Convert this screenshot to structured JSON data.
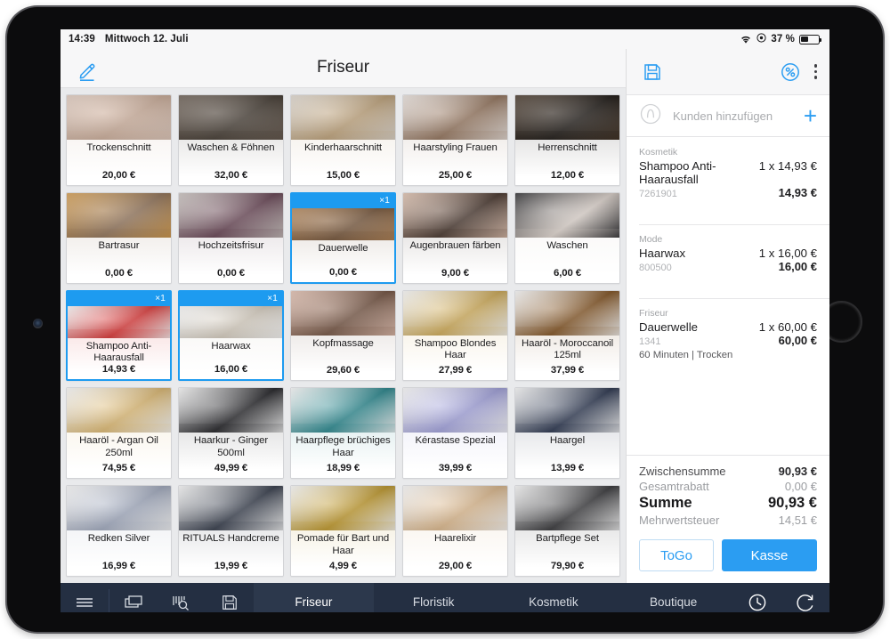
{
  "status_bar": {
    "time": "14:39",
    "date": "Mittwoch 12. Juli",
    "battery_percent": "37 %",
    "wifi_icon": "wifi-icon",
    "location_icon": "location-icon",
    "battery_icon": "battery-icon"
  },
  "left_header": {
    "edit_icon": "pencil-edit-icon",
    "title": "Friseur"
  },
  "products": [
    {
      "name": "Trockenschnitt",
      "price": "20,00 €",
      "selected": false,
      "qty": "",
      "img": "haircut-dry",
      "c1": "#e6d0c3",
      "c2": "#c6a793"
    },
    {
      "name": "Waschen & Föhnen",
      "price": "32,00 €",
      "selected": false,
      "qty": "",
      "img": "hair-wash",
      "c1": "#6d6055",
      "c2": "#3a3128"
    },
    {
      "name": "Kinderhaarschnitt",
      "price": "15,00 €",
      "selected": false,
      "qty": "",
      "img": "kids-haircut",
      "c1": "#e4ddd4",
      "c2": "#b79a71"
    },
    {
      "name": "Haarstyling Frauen",
      "price": "25,00 €",
      "selected": false,
      "qty": "",
      "img": "women-styling",
      "c1": "#efe7e2",
      "c2": "#8b6b53"
    },
    {
      "name": "Herrenschnitt",
      "price": "12,00 €",
      "selected": false,
      "qty": "",
      "img": "mens-cut",
      "c1": "#4a3a2c",
      "c2": "#120d09"
    },
    {
      "name": "Bartrasur",
      "price": "0,00 €",
      "selected": false,
      "qty": "",
      "img": "beard-shave",
      "c1": "#d9a050",
      "c2": "#8a6b50"
    },
    {
      "name": "Hochzeitsfrisur",
      "price": "0,00 €",
      "selected": false,
      "qty": "",
      "img": "wedding-updo",
      "c1": "#cfc8c4",
      "c2": "#5e3a4a"
    },
    {
      "name": "Dauerwelle",
      "price": "0,00 €",
      "selected": true,
      "qty": "×1",
      "img": "perm-curls",
      "c1": "#b98a5c",
      "c2": "#6b4a2e"
    },
    {
      "name": "Augenbrauen färben",
      "price": "9,00 €",
      "selected": false,
      "qty": "",
      "img": "eyebrow-tint",
      "c1": "#e6c7b4",
      "c2": "#3d2b22"
    },
    {
      "name": "Waschen",
      "price": "6,00 €",
      "selected": false,
      "qty": "",
      "img": "shampoo-rinse",
      "c1": "#2b2b2e",
      "c2": "#d9cfc8"
    },
    {
      "name": "Shampoo Anti-Haarausfall",
      "price": "14,93 €",
      "selected": true,
      "qty": "×1",
      "img": "alpecin-bottle",
      "c1": "#ffffff",
      "c2": "#d32a2a"
    },
    {
      "name": "Haarwax",
      "price": "16,00 €",
      "selected": true,
      "qty": "×1",
      "img": "hair-wax-jar",
      "c1": "#ffffff",
      "c2": "#cfc6b8"
    },
    {
      "name": "Kopfmassage",
      "price": "29,60 €",
      "selected": false,
      "qty": "",
      "img": "head-massage",
      "c1": "#e8c4b4",
      "c2": "#6b4a38"
    },
    {
      "name": "Shampoo Blondes Haar",
      "price": "27,99 €",
      "selected": false,
      "qty": "",
      "img": "blonde-shampoo",
      "c1": "#ffffff",
      "c2": "#c9a44e"
    },
    {
      "name": "Haaröl - Moroccanoil 125ml",
      "price": "37,99 €",
      "selected": false,
      "qty": "",
      "img": "moroccanoil",
      "c1": "#ffffff",
      "c2": "#7a4a18"
    },
    {
      "name": "Haaröl - Argan Oil 250ml",
      "price": "74,95 €",
      "selected": false,
      "qty": "",
      "img": "argan-oil",
      "c1": "#ffffff",
      "c2": "#d8b36a"
    },
    {
      "name": "Haarkur - Ginger 500ml",
      "price": "49,99 €",
      "selected": false,
      "qty": "",
      "img": "ginger-cure",
      "c1": "#ffffff",
      "c2": "#16161a"
    },
    {
      "name": "Haarpflege brüchiges Haar",
      "price": "18,99 €",
      "selected": false,
      "qty": "",
      "img": "kerastase-teal",
      "c1": "#ffffff",
      "c2": "#1e7f86"
    },
    {
      "name": "Kérastase Spezial",
      "price": "39,99 €",
      "selected": false,
      "qty": "",
      "img": "kerastase-purple",
      "c1": "#ffffff",
      "c2": "#9a9ad6"
    },
    {
      "name": "Haargel",
      "price": "13,99 €",
      "selected": false,
      "qty": "",
      "img": "elkos-haargel",
      "c1": "#ffffff",
      "c2": "#1f2a44"
    },
    {
      "name": "Redken Silver",
      "price": "16,99 €",
      "selected": false,
      "qty": "",
      "img": "redken-silver",
      "c1": "#ffffff",
      "c2": "#9aa3b8"
    },
    {
      "name": "RITUALS Handcreme",
      "price": "19,99 €",
      "selected": false,
      "qty": "",
      "img": "rituals-samurai",
      "c1": "#ffffff",
      "c2": "#2a3140"
    },
    {
      "name": "Pomade für Bart und Haar",
      "price": "4,99 €",
      "selected": false,
      "qty": "",
      "img": "pomade-tin",
      "c1": "#ffffff",
      "c2": "#b8901f"
    },
    {
      "name": "Haarelixir",
      "price": "29,00 €",
      "selected": false,
      "qty": "",
      "img": "hair-elixir",
      "c1": "#ffffff",
      "c2": "#d6b184"
    },
    {
      "name": "Bartpflege Set",
      "price": "79,90 €",
      "selected": false,
      "qty": "",
      "img": "beard-care-set",
      "c1": "#ffffff",
      "c2": "#2b2b2e"
    }
  ],
  "right_panel": {
    "save_icon": "floppy-save-icon",
    "discount_icon": "percent-discount-icon",
    "more_icon": "kebab-more-icon",
    "customer": {
      "avatar_icon": "person-outline-icon",
      "placeholder": "Kunden hinzufügen",
      "add_icon": "plus-icon"
    },
    "cart_items": [
      {
        "category": "Kosmetik",
        "name": "Shampoo Anti-Haarausfall",
        "qty_price": "1 x 14,93 €",
        "sku": "7261901",
        "total": "14,93 €",
        "note": ""
      },
      {
        "category": "Mode",
        "name": "Haarwax",
        "qty_price": "1 x 16,00 €",
        "sku": "800500",
        "total": "16,00 €",
        "note": ""
      },
      {
        "category": "Friseur",
        "name": "Dauerwelle",
        "qty_price": "1 x 60,00 €",
        "sku": "1341",
        "total": "60,00 €",
        "note": "60 Minuten | Trocken"
      }
    ],
    "totals": [
      {
        "label": "Zwischensumme",
        "value": "90,93 €",
        "style": "normal"
      },
      {
        "label": "Gesamtrabatt",
        "value": "0,00 €",
        "style": "muted"
      },
      {
        "label": "Summe",
        "value": "90,93 €",
        "style": "big"
      },
      {
        "label": "Mehrwertsteuer",
        "value": "14,51 €",
        "style": "muted"
      }
    ],
    "togo_label": "ToGo",
    "kasse_label": "Kasse"
  },
  "bottom_nav": {
    "icons_left": [
      "hamburger-menu-icon",
      "windows-stack-icon",
      "barcode-search-icon",
      "floppy-save-icon"
    ],
    "tabs": [
      {
        "label": "Friseur",
        "active": true
      },
      {
        "label": "Floristik",
        "active": false
      },
      {
        "label": "Kosmetik",
        "active": false
      },
      {
        "label": "Boutique",
        "active": false
      }
    ],
    "icons_right": [
      "clock-history-icon",
      "sync-refresh-icon"
    ]
  },
  "colors": {
    "accent": "#2b9df2",
    "nav_bg": "#242f42",
    "screen_bg": "#e9eaec"
  }
}
